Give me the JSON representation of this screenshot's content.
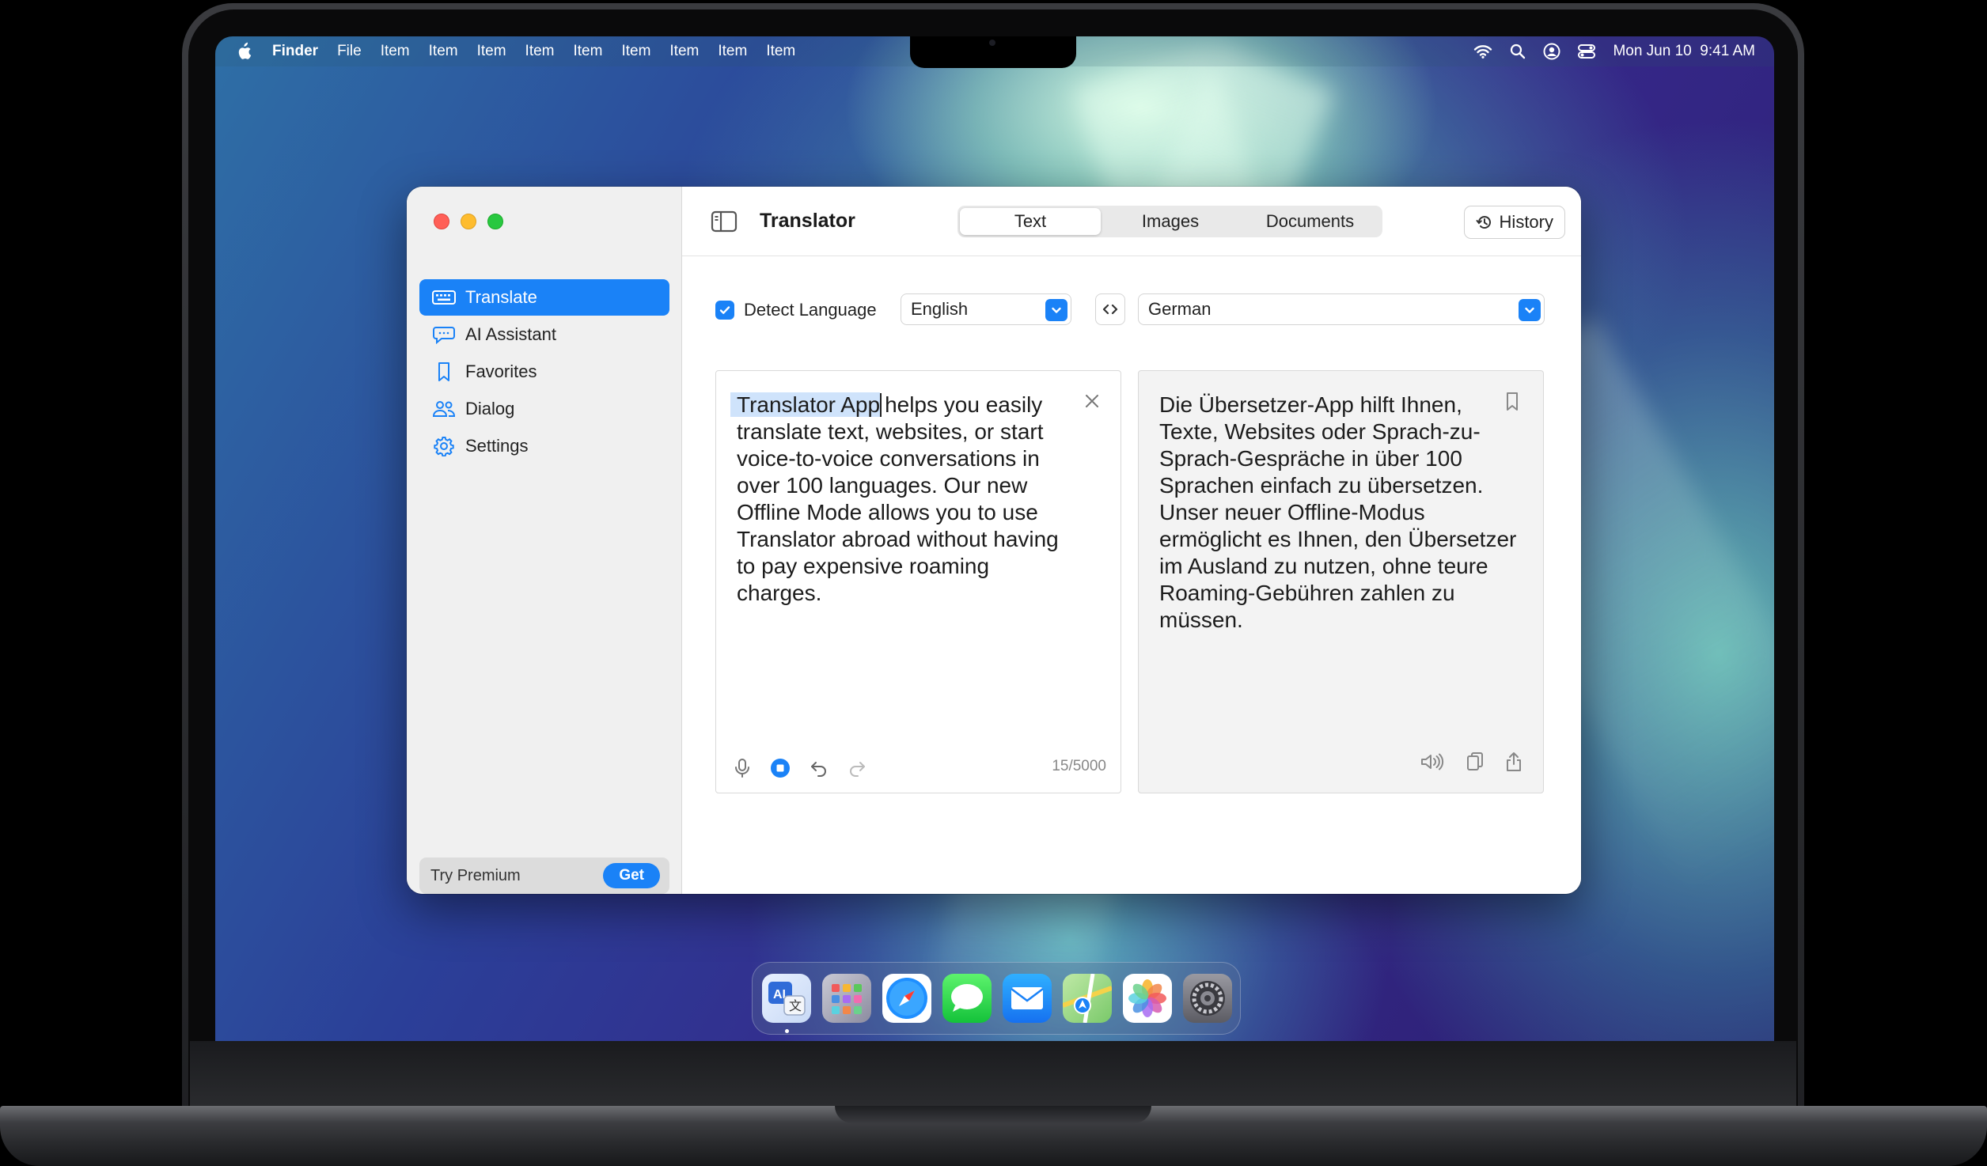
{
  "menubar": {
    "app_name": "Finder",
    "items": [
      "File",
      "Item",
      "Item",
      "Item",
      "Item",
      "Item",
      "Item",
      "Item",
      "Item",
      "Item"
    ],
    "datetime": "Mon Jun 10  9:41 AM"
  },
  "window": {
    "title": "Translator",
    "tabs": [
      "Text",
      "Images",
      "Documents"
    ],
    "history_label": "History",
    "sidebar": {
      "items": [
        {
          "label": "Translate",
          "icon": "keyboard-icon",
          "active": true
        },
        {
          "label": "AI Assistant",
          "icon": "chat-bubble-icon",
          "active": false
        },
        {
          "label": "Favorites",
          "icon": "bookmark-icon",
          "active": false
        },
        {
          "label": "Dialog",
          "icon": "people-icon",
          "active": false
        },
        {
          "label": "Settings",
          "icon": "gear-icon",
          "active": false
        }
      ],
      "premium_label": "Try Premium",
      "get_label": "Get"
    },
    "languages": {
      "detect_label": "Detect Language",
      "detect_checked": true,
      "source": "English",
      "target": "German"
    },
    "source_panel": {
      "selected_text": "Translator App",
      "rest_text": "helps you easily translate text, websites, or start voice-to-voice conversations in over 100 languages. Our new Offline Mode allows you to use Translator abroad without having to pay expensive roaming charges.",
      "char_count": "15/5000"
    },
    "target_panel": {
      "text": "Die Übersetzer-App hilft Ihnen, Texte, Websites oder Sprach-zu-Sprach-Gespräche in über 100 Sprachen einfach zu übersetzen. Unser neuer Offline-Modus ermöglicht es Ihnen, den Übersetzer im Ausland zu nutzen, ohne teure Roaming-Gebühren zahlen zu müssen."
    }
  },
  "dock": {
    "apps": [
      "translator-app-icon",
      "launchpad-icon",
      "safari-icon",
      "messages-icon",
      "mail-icon",
      "maps-icon",
      "photos-icon",
      "system-settings-icon"
    ]
  },
  "colors": {
    "accent": "#1a82f7",
    "selection": "#cfe3fb"
  }
}
